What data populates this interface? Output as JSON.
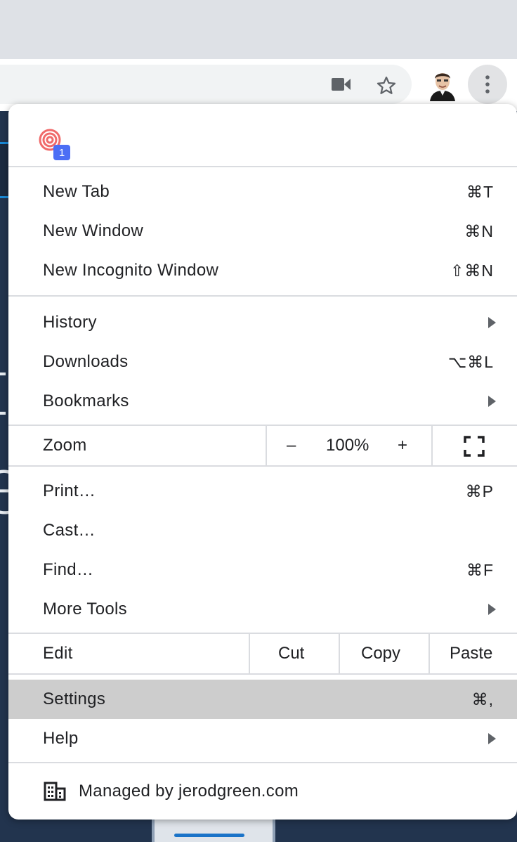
{
  "toolbar": {
    "icons": [
      "video-camera-icon",
      "star-icon",
      "avatar",
      "three-dot-menu-icon"
    ]
  },
  "extension": {
    "badge": "1"
  },
  "menu": {
    "group1": [
      {
        "label": "New Tab",
        "shortcut": "⌘T"
      },
      {
        "label": "New Window",
        "shortcut": "⌘N"
      },
      {
        "label": "New Incognito Window",
        "shortcut": "⇧⌘N"
      }
    ],
    "group2": [
      {
        "label": "History",
        "shortcut": ""
      },
      {
        "label": "Downloads",
        "shortcut": "⌥⌘L"
      },
      {
        "label": "Bookmarks",
        "shortcut": ""
      }
    ],
    "zoom": {
      "label": "Zoom",
      "minus": "–",
      "value": "100%",
      "plus": "+"
    },
    "group3": [
      {
        "label": "Print…",
        "shortcut": "⌘P"
      },
      {
        "label": "Cast…",
        "shortcut": ""
      },
      {
        "label": "Find…",
        "shortcut": "⌘F"
      },
      {
        "label": "More Tools",
        "shortcut": ""
      }
    ],
    "edit": {
      "label": "Edit",
      "cut": "Cut",
      "copy": "Copy",
      "paste": "Paste"
    },
    "group4": [
      {
        "label": "Settings",
        "shortcut": "⌘,"
      },
      {
        "label": "Help",
        "shortcut": ""
      }
    ],
    "managed": "Managed by jerodgreen.com"
  },
  "colors": {
    "highlight": "#cdcdcd",
    "badge": "#4c6ef5",
    "page_bg": "#22344e"
  }
}
